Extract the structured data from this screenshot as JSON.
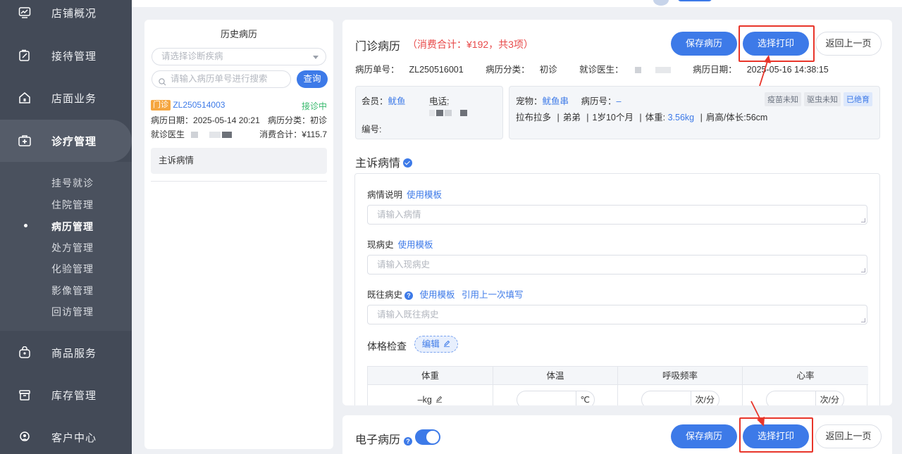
{
  "sidebar": {
    "main_items": [
      {
        "label": "店铺概况",
        "icon": "chart-icon"
      },
      {
        "label": "接待管理",
        "icon": "clipboard-icon"
      },
      {
        "label": "店面业务",
        "icon": "home-icon"
      },
      {
        "label": "诊疗管理",
        "icon": "medical-kit-icon"
      },
      {
        "label": "商品服务",
        "icon": "bag-icon"
      },
      {
        "label": "库存管理",
        "icon": "box-icon"
      },
      {
        "label": "客户中心",
        "icon": "user-icon"
      }
    ],
    "sub_items": [
      "挂号就诊",
      "住院管理",
      "病历管理",
      "处方管理",
      "化验管理",
      "影像管理",
      "回访管理"
    ],
    "active_sub": "病历管理"
  },
  "history": {
    "title": "历史病历",
    "disease_placeholder": "请选择诊断疾病",
    "search_placeholder": "请输入病历单号进行搜索",
    "query_label": "查询",
    "records": [
      {
        "type_tag": "门诊",
        "record_no": "ZL250514003",
        "status": "接诊中",
        "date_label": "病历日期：",
        "date": "2025-05-14 20:21",
        "category_label": "病历分类：",
        "category": "初诊",
        "doctor_label": "就诊医生",
        "total_label": "消费合计：",
        "total": "¥115.7"
      }
    ],
    "complaint_item": "主诉病情"
  },
  "main": {
    "title": "门诊病历",
    "summary": "（消费合计：¥192，共3项）",
    "save_label": "保存病历",
    "print_label": "选择打印",
    "back_label": "返回上一页",
    "info": {
      "record_no_label": "病历单号：",
      "record_no": "ZL250516001",
      "category_label": "病历分类：",
      "category": "初诊",
      "doctor_label": "就诊医生：",
      "date_label": "病历日期：",
      "date": "2025-05-16 14:38:15"
    },
    "member": {
      "member_label": "会员：",
      "member_name": "鱿鱼",
      "phone_label": "电话:",
      "id_label": "编号:"
    },
    "pet": {
      "pet_label": "宠物：",
      "pet_name": "鱿鱼串",
      "record_label": "病历号：",
      "record_value": "–",
      "tags": [
        "疫苗未知",
        "驱虫未知",
        "已绝育"
      ],
      "breed": "拉布拉多",
      "gender": "弟弟",
      "age": "1岁10个月",
      "weight_label": "体重:",
      "weight": "3.56kg",
      "height": "肩高/体长:56cm"
    },
    "complaint": {
      "title": "主诉病情",
      "condition_label": "病情说明",
      "use_template": "使用模板",
      "condition_placeholder": "请输入病情",
      "current_label": "现病史",
      "current_placeholder": "请输入现病史",
      "past_label": "既往病史",
      "reuse_last": "引用上一次填写",
      "past_placeholder": "请输入既往病史",
      "exam_label": "体格检查",
      "edit_label": "编辑"
    },
    "vitals": {
      "headers": [
        "体重",
        "体温",
        "呼吸频率",
        "心率"
      ],
      "weight_value": "–kg",
      "temp_unit": "℃",
      "resp_unit": "次/分",
      "heart_unit": "次/分"
    }
  },
  "bottom": {
    "title": "电子病历",
    "save_label": "保存病历",
    "print_label": "选择打印",
    "back_label": "返回上一页"
  },
  "colors": {
    "sidebar": "#434a57",
    "primary": "#3d7ae8",
    "alert": "#e84a4a",
    "highlight_box": "#e8352a",
    "status_green": "#35b86b",
    "tag_orange": "#f5a640"
  }
}
